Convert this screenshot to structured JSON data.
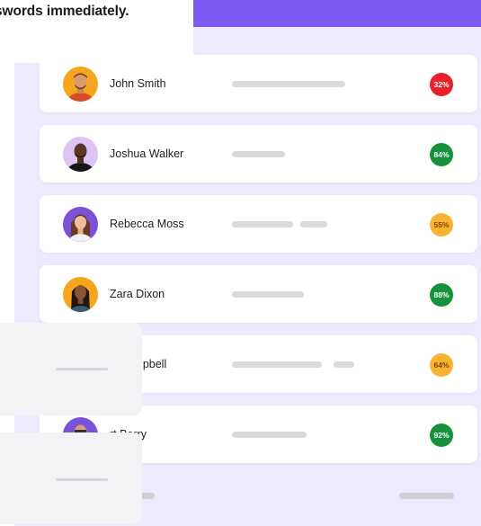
{
  "headline": "swords immediately.",
  "rows": [
    {
      "name": "John Smith",
      "score": "32%",
      "score_color": "#e8212a"
    },
    {
      "name": "Joshua Walker",
      "score": "84%",
      "score_color": "#16923d"
    },
    {
      "name": "Rebecca Moss",
      "score": "55%",
      "score_color": "#f9b233"
    },
    {
      "name": "Zara Dixon",
      "score": "88%",
      "score_color": "#16923d"
    },
    {
      "name": "e Campbell",
      "score": "64%",
      "score_color": "#f9b233"
    },
    {
      "name": "rt Berry",
      "score": "92%",
      "score_color": "#16923d"
    }
  ],
  "icons": {
    "avatar": "person-avatar-icon"
  },
  "colors": {
    "header": "#7c5cf5",
    "panel": "#efe9fd",
    "placeholder_card": "#f3f3f5"
  }
}
